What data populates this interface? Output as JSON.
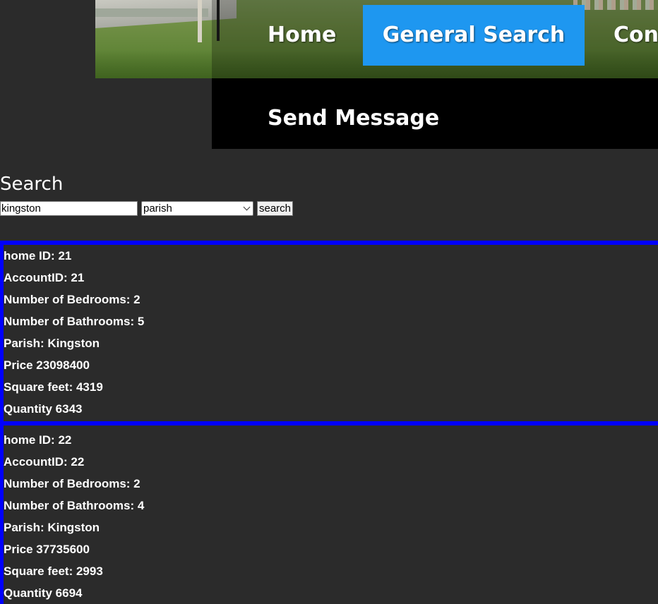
{
  "nav": {
    "home": "Home",
    "general_search": "General Search",
    "contact_partial": "Con",
    "send_message": "Send Message"
  },
  "search": {
    "heading": "Search",
    "query_value": "kingston",
    "filter_selected": "parish",
    "button_label": "search"
  },
  "results": [
    {
      "home_id": "home ID: 21",
      "account_id": "AccountID: 21",
      "bedrooms": "Number of Bedrooms: 2",
      "bathrooms": "Number of Bathrooms: 5",
      "parish": "Parish: Kingston",
      "price": "Price 23098400",
      "square_feet": "Square feet: 4319",
      "quantity": "Quantity 6343"
    },
    {
      "home_id": "home ID: 22",
      "account_id": "AccountID: 22",
      "bedrooms": "Number of Bedrooms: 2",
      "bathrooms": "Number of Bathrooms: 4",
      "parish": "Parish: Kingston",
      "price": "Price 37735600",
      "square_feet": "Square feet: 2993",
      "quantity": "Quantity 6694"
    }
  ],
  "colors": {
    "background": "#2b2b2b",
    "nav_active": "#1e97f0",
    "card_border": "#0000ff",
    "nav_bar_dark": "#000000"
  }
}
